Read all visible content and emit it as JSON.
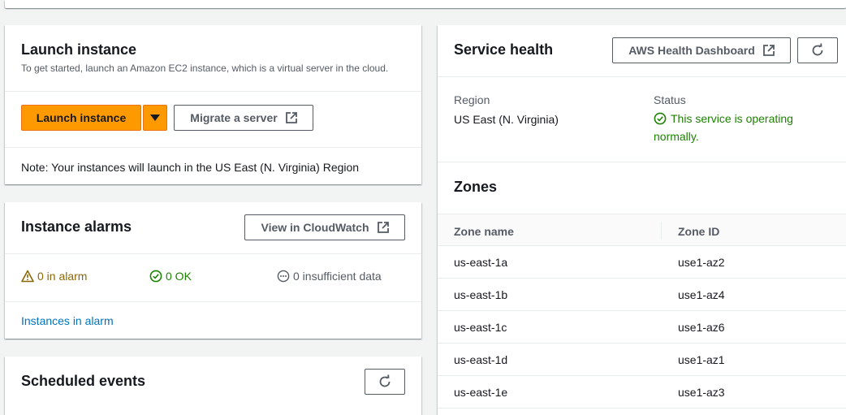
{
  "launch": {
    "title": "Launch instance",
    "subtitle": "To get started, launch an Amazon EC2 instance, which is a virtual server in the cloud.",
    "launch_button": "Launch instance",
    "migrate_button": "Migrate a server",
    "note": "Note: Your instances will launch in the US East (N. Virginia) Region"
  },
  "alarms": {
    "title": "Instance alarms",
    "cloudwatch_button": "View in CloudWatch",
    "in_alarm": "0 in alarm",
    "ok": "0 OK",
    "insufficient": "0 insufficient data",
    "link": "Instances in alarm"
  },
  "events": {
    "title": "Scheduled events"
  },
  "health": {
    "title": "Service health",
    "dashboard_button": "AWS Health Dashboard",
    "region_label": "Region",
    "region_value": "US East (N. Virginia)",
    "status_label": "Status",
    "status_line1": "This service is operating",
    "status_line2": "normally."
  },
  "zones": {
    "title": "Zones",
    "col_name": "Zone name",
    "col_id": "Zone ID",
    "rows": [
      {
        "name": "us-east-1a",
        "id": "use1-az2"
      },
      {
        "name": "us-east-1b",
        "id": "use1-az4"
      },
      {
        "name": "us-east-1c",
        "id": "use1-az6"
      },
      {
        "name": "us-east-1d",
        "id": "use1-az1"
      },
      {
        "name": "us-east-1e",
        "id": "use1-az3"
      }
    ]
  },
  "colors": {
    "primary": "#ff9900",
    "link": "#0073bb",
    "success": "#1d8102",
    "warning": "#8d6605"
  }
}
